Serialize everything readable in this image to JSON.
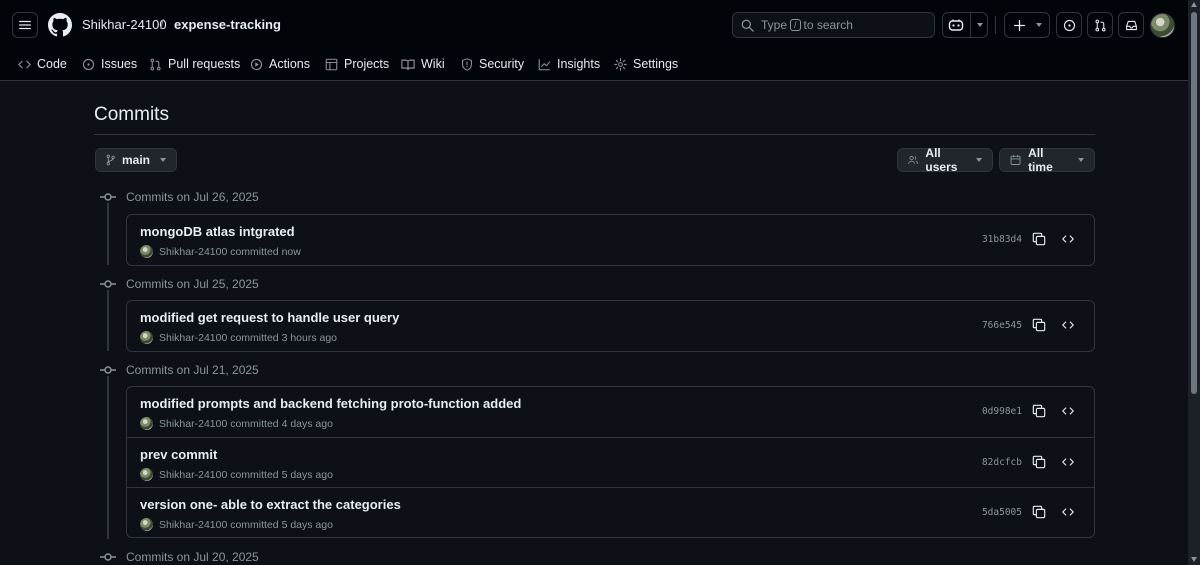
{
  "header": {
    "owner": "Shikhar-24100",
    "separator": "/",
    "repo": "expense-tracking",
    "search": {
      "prefix": "Type",
      "key": "/",
      "suffix": "to search"
    }
  },
  "tabs": [
    {
      "label": "Code",
      "icon": "code-icon"
    },
    {
      "label": "Issues",
      "icon": "issue-icon"
    },
    {
      "label": "Pull requests",
      "icon": "pull-request-icon"
    },
    {
      "label": "Actions",
      "icon": "play-icon"
    },
    {
      "label": "Projects",
      "icon": "table-icon"
    },
    {
      "label": "Wiki",
      "icon": "book-icon"
    },
    {
      "label": "Security",
      "icon": "shield-icon"
    },
    {
      "label": "Insights",
      "icon": "graph-icon"
    },
    {
      "label": "Settings",
      "icon": "gear-icon"
    }
  ],
  "page": {
    "title": "Commits",
    "branch": "main",
    "users_filter": "All users",
    "time_filter": "All time"
  },
  "groups": [
    {
      "heading": "Commits on Jul 26, 2025",
      "commits": [
        {
          "message": "mongoDB atlas intgrated",
          "author": "Shikhar-24100",
          "time": "committed now",
          "sha": "31b83d4"
        }
      ]
    },
    {
      "heading": "Commits on Jul 25, 2025",
      "commits": [
        {
          "message": "modified get request to handle user query",
          "author": "Shikhar-24100",
          "time": "committed 3 hours ago",
          "sha": "766e545"
        }
      ]
    },
    {
      "heading": "Commits on Jul 21, 2025",
      "commits": [
        {
          "message": "modified prompts and backend fetching proto-function added",
          "author": "Shikhar-24100",
          "time": "committed 4 days ago",
          "sha": "0d998e1"
        },
        {
          "message": "prev commit",
          "author": "Shikhar-24100",
          "time": "committed 5 days ago",
          "sha": "82dcfcb"
        },
        {
          "message": "version one- able to extract the categories",
          "author": "Shikhar-24100",
          "time": "committed 5 days ago",
          "sha": "5da5005"
        }
      ]
    },
    {
      "heading": "Commits on Jul 20, 2025",
      "commits": []
    }
  ],
  "colors": {
    "background": "#0d1117",
    "header_bg": "#010409",
    "border": "#30363d",
    "text": "#e6edf3",
    "muted": "#8b949e"
  }
}
